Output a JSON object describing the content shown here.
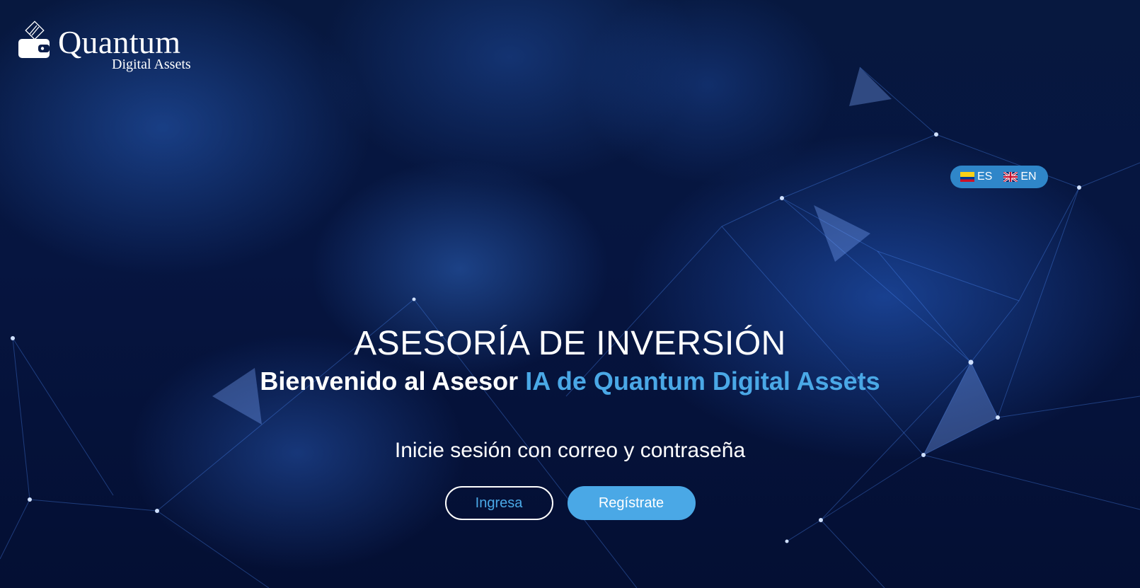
{
  "brand": {
    "name": "Quantum",
    "tagline": "Digital Assets"
  },
  "language_switch": {
    "options": [
      {
        "code": "ES",
        "flag_icon": "colombia-flag-icon"
      },
      {
        "code": "EN",
        "flag_icon": "uk-flag-icon"
      }
    ],
    "background_color": "#2f86c9"
  },
  "hero": {
    "title": "ASESORÍA DE INVERSIÓN",
    "subtitle_plain": "Bienvenido al Asesor ",
    "subtitle_accent": "IA de Quantum Digital Assets",
    "prompt": "Inicie sesión con correo y contraseña"
  },
  "actions": {
    "login_label": "Ingresa",
    "register_label": "Regístrate"
  },
  "colors": {
    "accent": "#4aa8e6",
    "background": "#061540",
    "text": "#ffffff"
  }
}
